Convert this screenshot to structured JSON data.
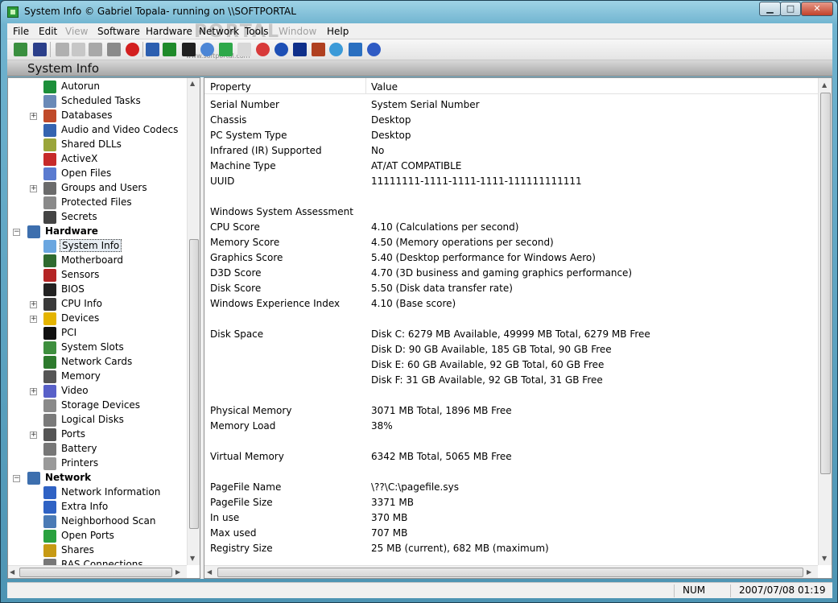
{
  "window": {
    "title": "System Info  © Gabriel Topala- running on \\\\SOFTPORTAL",
    "min_label": "▁",
    "max_label": "□",
    "close_label": "✕"
  },
  "menu": {
    "items": [
      {
        "label": "File",
        "enabled": true
      },
      {
        "label": "Edit",
        "enabled": true
      },
      {
        "label": "View",
        "enabled": false
      },
      {
        "label": "Software",
        "enabled": true
      },
      {
        "label": "Hardware",
        "enabled": true
      },
      {
        "label": "Network",
        "enabled": true
      },
      {
        "label": "Tools",
        "enabled": true
      },
      {
        "label": "Window",
        "enabled": false
      },
      {
        "label": "Help",
        "enabled": true
      }
    ],
    "watermark": "PORTAL"
  },
  "toolbar": {
    "watermark": "www.softportal.com",
    "icons": [
      "exit-icon",
      "save-icon",
      "cut-icon",
      "copy-icon",
      "paste-icon",
      "print-icon",
      "stop-icon",
      "report-icon",
      "performance-icon",
      "graph-icon",
      "network-icon",
      "refresh-icon",
      "document-icon",
      "clock-icon",
      "globe-icon",
      "shield-icon",
      "tools-icon",
      "web-icon",
      "info-icon",
      "help-icon"
    ]
  },
  "panel_header": {
    "title": "System Info"
  },
  "tree": {
    "items": [
      {
        "label": "Autorun",
        "icon": "autorun-icon",
        "level": 2
      },
      {
        "label": "Scheduled Tasks",
        "icon": "scheduled-tasks-icon",
        "level": 2
      },
      {
        "label": "Databases",
        "icon": "databases-icon",
        "level": 2,
        "expander": "+"
      },
      {
        "label": "Audio and Video Codecs",
        "icon": "codecs-icon",
        "level": 2
      },
      {
        "label": "Shared DLLs",
        "icon": "dll-icon",
        "level": 2
      },
      {
        "label": "ActiveX",
        "icon": "activex-icon",
        "level": 2
      },
      {
        "label": "Open Files",
        "icon": "open-files-icon",
        "level": 2
      },
      {
        "label": "Groups and Users",
        "icon": "users-icon",
        "level": 2,
        "expander": "+"
      },
      {
        "label": "Protected Files",
        "icon": "protected-files-icon",
        "level": 2
      },
      {
        "label": "Secrets",
        "icon": "secrets-icon",
        "level": 2
      },
      {
        "label": "Hardware",
        "icon": "hardware-icon",
        "level": 1,
        "expander": "-"
      },
      {
        "label": "System Info",
        "icon": "system-info-icon",
        "level": 2,
        "selected": true
      },
      {
        "label": "Motherboard",
        "icon": "motherboard-icon",
        "level": 2
      },
      {
        "label": "Sensors",
        "icon": "sensors-icon",
        "level": 2
      },
      {
        "label": "BIOS",
        "icon": "bios-icon",
        "level": 2
      },
      {
        "label": "CPU Info",
        "icon": "cpu-icon",
        "level": 2,
        "expander": "+"
      },
      {
        "label": "Devices",
        "icon": "devices-icon",
        "level": 2,
        "expander": "+"
      },
      {
        "label": "PCI",
        "icon": "pci-icon",
        "level": 2
      },
      {
        "label": "System Slots",
        "icon": "system-slots-icon",
        "level": 2
      },
      {
        "label": "Network Cards",
        "icon": "network-cards-icon",
        "level": 2
      },
      {
        "label": "Memory",
        "icon": "memory-icon",
        "level": 2
      },
      {
        "label": "Video",
        "icon": "video-icon",
        "level": 2,
        "expander": "+"
      },
      {
        "label": "Storage Devices",
        "icon": "storage-icon",
        "level": 2
      },
      {
        "label": "Logical Disks",
        "icon": "logical-disks-icon",
        "level": 2
      },
      {
        "label": "Ports",
        "icon": "ports-icon",
        "level": 2,
        "expander": "+"
      },
      {
        "label": "Battery",
        "icon": "battery-icon",
        "level": 2
      },
      {
        "label": "Printers",
        "icon": "printers-icon",
        "level": 2
      },
      {
        "label": "Network",
        "icon": "network-group-icon",
        "level": 1,
        "expander": "-"
      },
      {
        "label": "Network Information",
        "icon": "network-info-icon",
        "level": 2
      },
      {
        "label": "Extra Info",
        "icon": "extra-info-icon",
        "level": 2
      },
      {
        "label": "Neighborhood Scan",
        "icon": "neighborhood-icon",
        "level": 2
      },
      {
        "label": "Open Ports",
        "icon": "open-ports-icon",
        "level": 2
      },
      {
        "label": "Shares",
        "icon": "shares-icon",
        "level": 2
      },
      {
        "label": "RAS Connections",
        "icon": "ras-icon",
        "level": 2
      }
    ]
  },
  "table": {
    "columns": [
      "Property",
      "Value"
    ],
    "rows": [
      [
        "Serial Number",
        "System Serial Number"
      ],
      [
        "Chassis",
        "Desktop"
      ],
      [
        "PC System Type",
        "Desktop"
      ],
      [
        "Infrared (IR) Supported",
        "No"
      ],
      [
        "Machine Type",
        "AT/AT COMPATIBLE"
      ],
      [
        "UUID",
        "11111111-1111-1111-1111-111111111111"
      ],
      [
        "",
        ""
      ],
      [
        "Windows System Assessment",
        ""
      ],
      [
        "CPU Score",
        "4.10 (Calculations per second)"
      ],
      [
        "Memory Score",
        "4.50 (Memory operations per second)"
      ],
      [
        "Graphics Score",
        "5.40 (Desktop performance for Windows Aero)"
      ],
      [
        "D3D Score",
        "4.70 (3D business and gaming graphics performance)"
      ],
      [
        "Disk Score",
        "5.50 (Disk data transfer rate)"
      ],
      [
        "Windows Experience Index",
        "4.10 (Base score)"
      ],
      [
        "",
        ""
      ],
      [
        "Disk Space",
        "Disk C: 6279 MB Available, 49999 MB Total, 6279 MB Free"
      ],
      [
        "",
        "Disk D: 90 GB Available, 185 GB Total, 90 GB Free"
      ],
      [
        "",
        "Disk E: 60 GB Available, 92 GB Total, 60 GB Free"
      ],
      [
        "",
        "Disk F: 31 GB Available, 92 GB Total, 31 GB Free"
      ],
      [
        "",
        ""
      ],
      [
        "Physical Memory",
        "3071 MB Total, 1896 MB Free"
      ],
      [
        "Memory Load",
        "38%"
      ],
      [
        "",
        ""
      ],
      [
        "Virtual Memory",
        "6342 MB Total, 5065 MB Free"
      ],
      [
        "",
        ""
      ],
      [
        "PageFile Name",
        "\\??\\C:\\pagefile.sys"
      ],
      [
        "PageFile Size",
        "3371 MB"
      ],
      [
        "In use",
        "370 MB"
      ],
      [
        "Max used",
        "707 MB"
      ],
      [
        "Registry Size",
        "25 MB (current), 682 MB (maximum)"
      ]
    ]
  },
  "statusbar": {
    "num": "NUM",
    "datetime": "2007/07/08 01:19"
  },
  "colors": {
    "titlebar": "#6fb3cf",
    "selection": "#e8eef4"
  }
}
